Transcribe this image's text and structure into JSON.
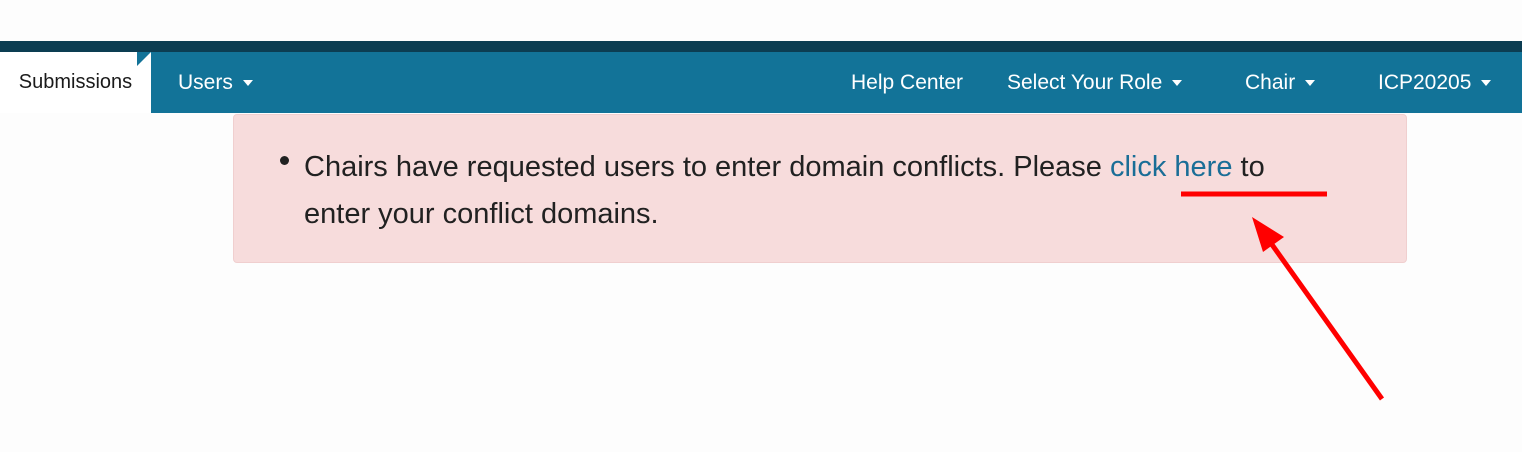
{
  "navbar": {
    "active_tab": "Submissions",
    "users": "Users",
    "help_center": "Help Center",
    "select_role": "Select Your Role",
    "chair": "Chair",
    "conference": "ICP20205"
  },
  "alert": {
    "text_before": "Chairs have requested users to enter domain conflicts. Please ",
    "link_text": "click here",
    "text_after": " to",
    "line2": "enter your conflict domains."
  },
  "colors": {
    "navbar": "#127398",
    "top_strip": "#0c3d52",
    "alert_bg": "#f7dcdc",
    "link": "#1a6e97",
    "annotation": "#ff0000"
  }
}
